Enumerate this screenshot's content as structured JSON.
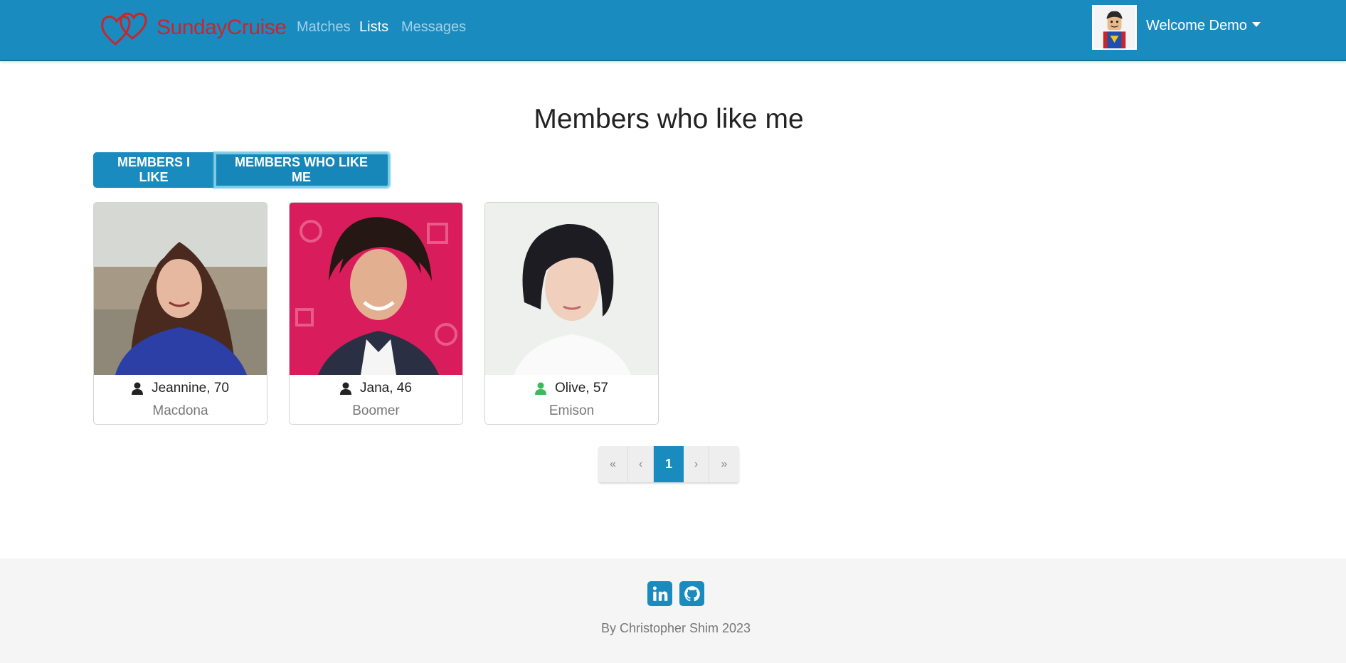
{
  "navbar": {
    "brand": "SundayCruise",
    "links": [
      {
        "label": "Matches",
        "active": false
      },
      {
        "label": "Lists",
        "active": true
      },
      {
        "label": "Messages",
        "active": false
      }
    ],
    "welcome": "Welcome Demo"
  },
  "main": {
    "title": "Members who like me",
    "tabs": [
      {
        "label": "MEMBERS I LIKE",
        "selected": false
      },
      {
        "label": "MEMBERS WHO LIKE ME",
        "selected": true
      }
    ],
    "members": [
      {
        "name": "Jeannine, 70",
        "city": "Macdona",
        "online": false
      },
      {
        "name": "Jana, 46",
        "city": "Boomer",
        "online": false
      },
      {
        "name": "Olive, 57",
        "city": "Emison",
        "online": true
      }
    ],
    "pagination": {
      "first": "«",
      "prev": "‹",
      "current": "1",
      "next": "›",
      "last": "»"
    }
  },
  "footer": {
    "copyright": "By Christopher Shim 2023",
    "social": [
      "linkedin-icon",
      "github-icon"
    ]
  },
  "colors": {
    "primary": "#1a8bbf",
    "brand_red": "#c8262c",
    "online_green": "#3cb95a",
    "offline_dark": "#222222"
  }
}
